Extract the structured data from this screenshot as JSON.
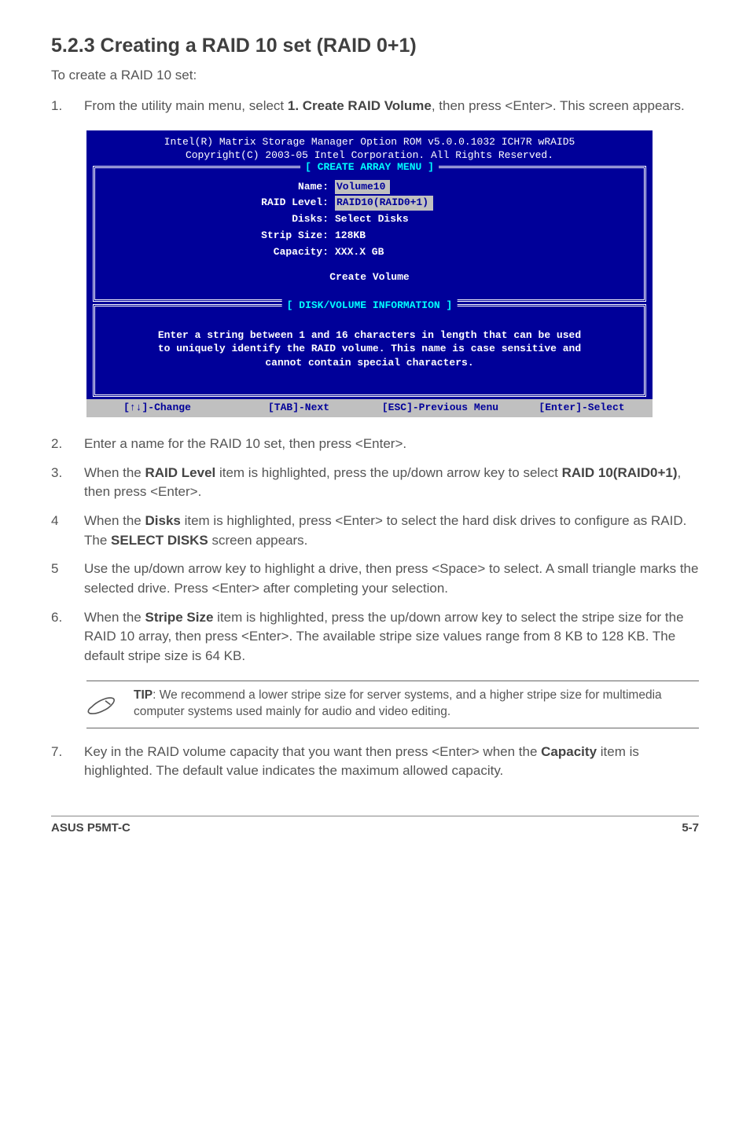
{
  "heading": "5.2.3   Creating a RAID 10 set (RAID 0+1)",
  "intro": "To create a RAID 10 set:",
  "step1_pre": "From the utility main menu, select ",
  "step1_bold": "1. Create RAID Volume",
  "step1_post": ", then press <Enter>. This screen appears.",
  "bios": {
    "header": "Intel(R) Matrix Storage Manager Option ROM v5.0.0.1032 ICH7R wRAID5\nCopyright(C) 2003-05 Intel Corporation. All Rights Reserved.",
    "panel1_title": "[ CREATE ARRAY MENU ]",
    "fields": {
      "name_label": "Name:",
      "name_value": "Volume10",
      "raid_label": "RAID Level:",
      "raid_value": "RAID10(RAID0+1)",
      "disks_label": "Disks:",
      "disks_value": "Select Disks",
      "strip_label": "Strip Size:",
      "strip_value": "128KB",
      "cap_label": "Capacity:",
      "cap_value": "XXX.X GB"
    },
    "create": "Create Volume",
    "panel2_title": "[ DISK/VOLUME INFORMATION ]",
    "help": "Enter a string between 1 and 16 characters in length that can be used\nto uniquely identify the RAID volume. This name is case sensitive and\ncannot contain special characters.",
    "footer": {
      "c1": "[↑↓]-Change",
      "c2": "[TAB]-Next",
      "c3": "[ESC]-Previous Menu",
      "c4": "[Enter]-Select"
    }
  },
  "step2": "Enter a name for the RAID 10 set, then press <Enter>.",
  "step3_a": "When the ",
  "step3_b1": "RAID Level",
  "step3_c": " item is highlighted, press the up/down arrow key to select ",
  "step3_b2": "RAID 10(RAID0+1)",
  "step3_d": ", then press <Enter>.",
  "step4_a": "When the ",
  "step4_b1": "Disks",
  "step4_c": " item is highlighted, press <Enter> to select the hard disk drives to configure as RAID. The ",
  "step4_b2": "SELECT DISKS",
  "step4_d": " screen appears.",
  "step5": "Use the up/down arrow key to highlight a drive, then press <Space> to select. A small triangle marks the selected drive. Press <Enter> after completing your selection.",
  "step6_a": "When the ",
  "step6_b1": "Stripe Size",
  "step6_c": " item is highlighted, press the up/down arrow key to select the stripe size for the RAID 10 array, then press <Enter>. The available stripe size values range from 8 KB to 128 KB. The default stripe size is 64 KB.",
  "tip_b": "TIP",
  "tip_text": ": We recommend a lower stripe size for server systems, and a higher stripe size for multimedia computer systems used mainly for audio and video editing.",
  "step7_a": "Key in the RAID volume capacity that you want then press <Enter> when the ",
  "step7_b1": "Capacity",
  "step7_c": " item is highlighted. The default value indicates the maximum allowed capacity.",
  "footer_left": "ASUS P5MT-C",
  "footer_right": "5-7"
}
